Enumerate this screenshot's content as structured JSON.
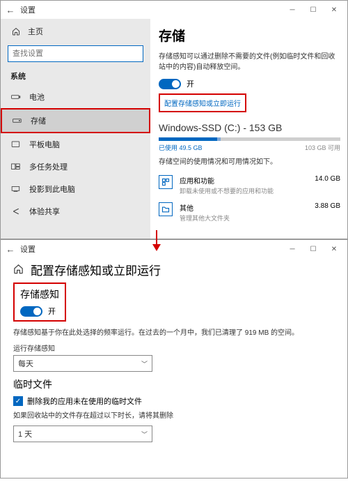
{
  "top": {
    "titlebar": {
      "title": "设置"
    },
    "sidebar": {
      "home": "主页",
      "search_placeholder": "查找设置",
      "section": "系统",
      "items": [
        {
          "label": "电池"
        },
        {
          "label": "存储",
          "selected": true
        },
        {
          "label": "平板电脑"
        },
        {
          "label": "多任务处理"
        },
        {
          "label": "投影到此电脑"
        },
        {
          "label": "体验共享"
        }
      ]
    },
    "content": {
      "title": "存储",
      "desc": "存储感知可以通过删除不需要的文件(例如临时文件和回收站中的内容)自动释放空间。",
      "toggle_label": "开",
      "link": "配置存储感知或立即运行",
      "drive": {
        "name": "Windows-SSD (C:) - 153 GB",
        "used_label": "已使用 49.5 GB",
        "free_label": "103 GB 可用",
        "used_pct": 32,
        "seg2_pct": 2
      },
      "drive_note": "存储空间的使用情况和可用情况如下。",
      "categories": [
        {
          "name": "应用和功能",
          "size": "14.0 GB",
          "sub": "卸载未使用或不想要的应用和功能"
        },
        {
          "name": "其他",
          "size": "3.88 GB",
          "sub": "管理其他大文件夹"
        }
      ]
    }
  },
  "bottom": {
    "titlebar": {
      "title": "设置"
    },
    "title": "配置存储感知或立即运行",
    "sense_header": "存储感知",
    "toggle_label": "开",
    "sense_note": "存储感知基于你在此处选择的频率运行。在过去的一个月中，我们已清理了 919 MB 的空间。",
    "run_label": "运行存储感知",
    "run_value": "每天",
    "temp_header": "临时文件",
    "chk_label": "删除我的应用未在使用的临时文件",
    "recycle_note": "如果回收站中的文件存在超过以下时长，请将其删除",
    "recycle_value": "1 天"
  }
}
